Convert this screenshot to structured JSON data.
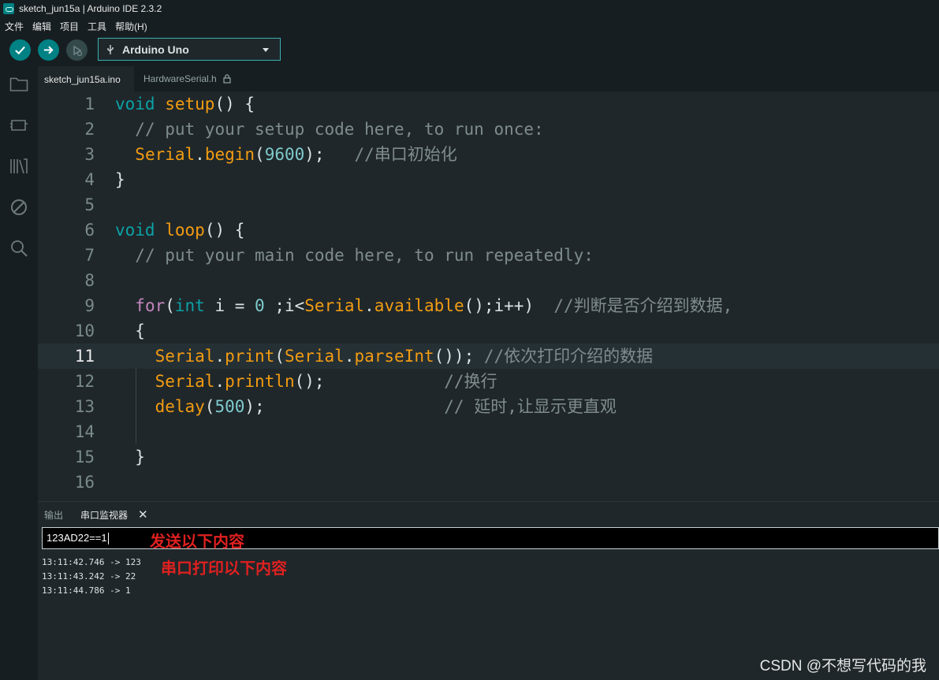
{
  "window": {
    "title": "sketch_jun15a | Arduino IDE 2.3.2"
  },
  "menu": [
    "文件",
    "编辑",
    "项目",
    "工具",
    "帮助(H)"
  ],
  "toolbar": {
    "board": "Arduino Uno"
  },
  "tabs": [
    {
      "label": "sketch_jun15a.ino",
      "active": true
    },
    {
      "label": "HardwareSerial.h",
      "locked": true
    }
  ],
  "editor": {
    "current_line": 11,
    "lines": [
      "1",
      "2",
      "3",
      "4",
      "5",
      "6",
      "7",
      "8",
      "9",
      "10",
      "11",
      "12",
      "13",
      "14",
      "15",
      "16"
    ]
  },
  "panel": {
    "tabs": [
      "输出",
      "串口监视器"
    ],
    "input_value": "123AD22==1",
    "annotation_send": "发送以下内容",
    "annotation_print": "串口打印以下内容",
    "output": [
      "13:11:42.746 -> 123",
      "13:11:43.242 -> 22",
      "13:11:44.786 -> 1"
    ]
  },
  "watermark": "CSDN @不想写代码的我",
  "colors": {
    "accent": "#008184",
    "keyword": "#0ca1a6",
    "function": "#f39c12",
    "comment": "#7f8c8d",
    "annotation": "#e02020"
  }
}
